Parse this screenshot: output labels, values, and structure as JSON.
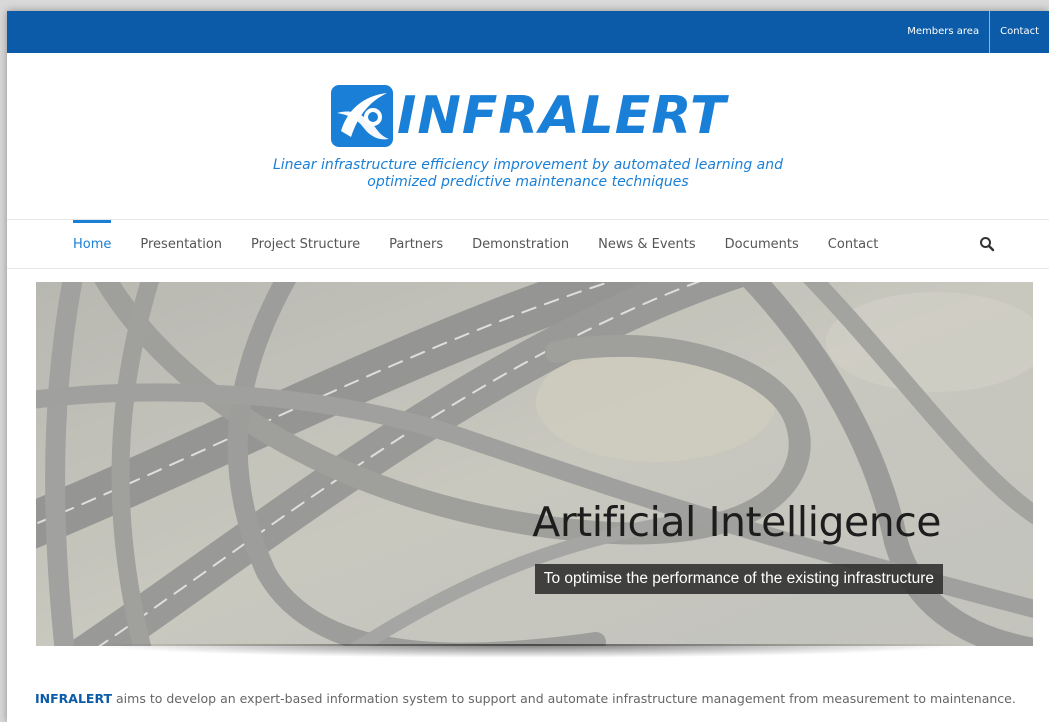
{
  "topbar": {
    "links": [
      "Members area",
      "Contact"
    ],
    "color": "#0b5ba8"
  },
  "logo": {
    "wordmark": "INFRALERT",
    "icon": "infralert-logo-mark",
    "tagline_line1": "Linear infrastructure efficiency improvement by automated learning and",
    "tagline_line2": "optimized predictive maintenance techniques",
    "color": "#1a7fd6"
  },
  "nav": {
    "items": [
      "Home",
      "Presentation",
      "Project Structure",
      "Partners",
      "Demonstration",
      "News & Events",
      "Documents",
      "Contact"
    ],
    "active": "Home",
    "search_icon": "search-icon"
  },
  "hero": {
    "title": "Artificial Intelligence",
    "subtitle": "To optimise the performance of the existing infrastructure",
    "image": "highway-interchange-aerial-photo"
  },
  "intro": {
    "brand": "INFRALERT",
    "text": " aims to develop an expert-based information system to support and automate infrastructure management from measurement to maintenance."
  }
}
